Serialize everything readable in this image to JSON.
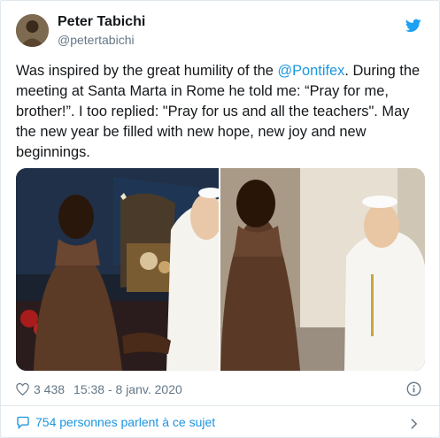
{
  "tweet": {
    "author_name": "Peter Tabichi",
    "author_handle": "@petertabichi",
    "text_before_mention": "Was inspired by the great humility of the ",
    "mention": "@Pontifex",
    "text_after_mention": ". During the meeting at Santa Marta in Rome he told me: “Pray for me, brother!”. I too replied: \"Pray for us and all the teachers\". May the new year be filled with new hope, new joy and new beginnings.",
    "likes": "3 438",
    "timestamp": "15:38 - 8 janv. 2020",
    "conversation": "754 personnes parlent à ce sujet"
  },
  "icons": {
    "brand": "twitter-bird-icon",
    "like": "heart-icon",
    "info": "info-icon",
    "reply": "speech-bubble-icon",
    "chevron": "chevron-right-icon"
  },
  "colors": {
    "accent": "#1da1f2",
    "link": "#1b95e0",
    "muted": "#657786",
    "text": "#14171a",
    "border": "#e1e8ed"
  }
}
